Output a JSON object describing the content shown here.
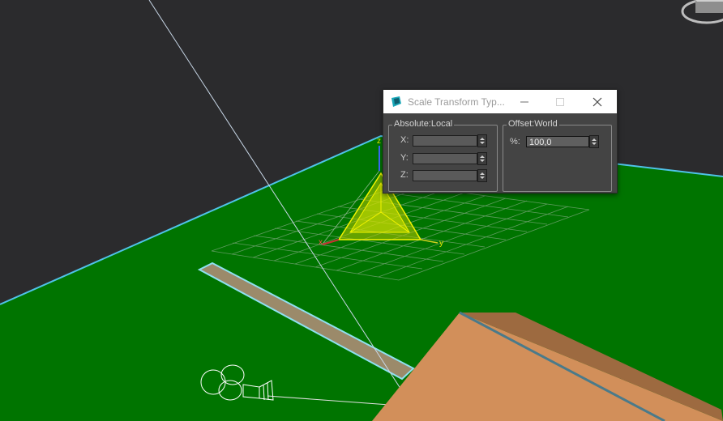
{
  "dialog": {
    "title": "Scale Transform Typ...",
    "minimize_icon": "minimize-icon",
    "maximize_icon": "maximize-icon",
    "close_icon": "close-icon"
  },
  "absolute": {
    "legend": "Absolute:Local",
    "x_label": "X:",
    "y_label": "Y:",
    "z_label": "Z:",
    "x_value": "",
    "y_value": "",
    "z_value": ""
  },
  "offset": {
    "legend": "Offset:World",
    "percent_label": "%:",
    "percent_value": "100,0"
  },
  "gizmo": {
    "x_axis": "x",
    "y_axis": "y",
    "z_axis": "z"
  },
  "colors": {
    "ground": "#007400",
    "ground_edge": "#4fc3e8",
    "background": "#2b2b2d",
    "gizmo": "#f4f400",
    "roof": "#d28f5a"
  }
}
